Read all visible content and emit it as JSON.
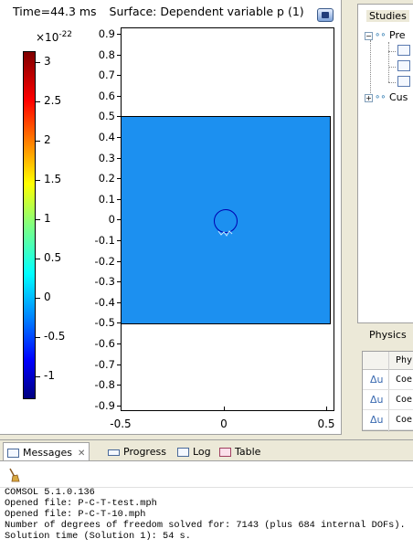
{
  "graphics": {
    "time_label": "Time=44.3 ms",
    "surface_label": "Surface: Dependent variable p (1)",
    "colorbar": {
      "exponent_base": "×10",
      "exponent_power": "-22",
      "labels": [
        "3",
        "2.5",
        "2",
        "1.5",
        "1",
        "0.5",
        "0",
        "-0.5",
        "-1"
      ],
      "colormap": "rainbow"
    },
    "y_ticks": [
      "0.9",
      "0.8",
      "0.7",
      "0.6",
      "0.5",
      "0.4",
      "0.3",
      "0.2",
      "0.1",
      "0",
      "-0.1",
      "-0.2",
      "-0.3",
      "-0.4",
      "-0.5",
      "-0.6",
      "-0.7",
      "-0.8",
      "-0.9"
    ],
    "x_ticks": [
      "-0.5",
      "0",
      "0.5"
    ],
    "domain": {
      "x_range": [
        -0.5,
        0.5
      ],
      "y_range": [
        -0.5,
        0.5
      ],
      "fill_color": "#1c90f0"
    },
    "inclusion": {
      "shape": "circle",
      "center": [
        0,
        0
      ],
      "stroke_color": "#0000b0"
    }
  },
  "sidebar": {
    "studies_title": "Studies",
    "tree": [
      {
        "label": "Pre",
        "expander": "−"
      },
      {
        "label": "Cus",
        "expander": "+"
      }
    ],
    "physics_title": "Physics",
    "physics_header": "Phy",
    "physics_rows": [
      {
        "icon": "Δu",
        "name": "Coe"
      },
      {
        "icon": "Δu",
        "name": "Coe"
      },
      {
        "icon": "Δu",
        "name": "Coe"
      }
    ]
  },
  "bottom": {
    "tabs": [
      {
        "label": "Messages",
        "active": true
      },
      {
        "label": "Progress",
        "active": false
      },
      {
        "label": "Log",
        "active": false
      },
      {
        "label": "Table",
        "active": false
      }
    ],
    "messages": [
      "COMSOL 5.1.0.136",
      "Opened file: P-C-T-test.mph",
      "Opened file: P-C-T-10.mph",
      "Number of degrees of freedom solved for: 7143 (plus 684 internal DOFs).",
      "Solution time (Solution 1): 54 s."
    ]
  }
}
